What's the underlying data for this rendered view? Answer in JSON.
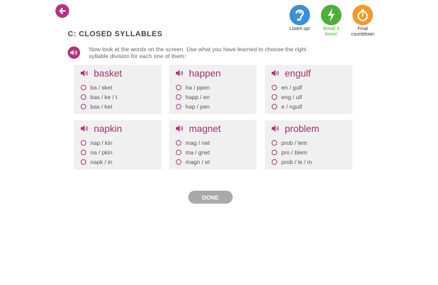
{
  "toolbar": {
    "listen": {
      "label": "Listen up!",
      "color": "#3a8fd6"
    },
    "break": {
      "label": "Break it down!",
      "color": "#4fae3a"
    },
    "final": {
      "label": "Final countdown",
      "color": "#f29a2e"
    }
  },
  "section": {
    "title": "C:  CLOSED SYLLABLES"
  },
  "instructions": "Now look at the words on the screen. Use what you have learned to choose the right syllable division for each one of them:",
  "cards": [
    {
      "word": "basket",
      "options": [
        "ba / sket",
        "bas / ke / t",
        "bas / ket"
      ]
    },
    {
      "word": "happen",
      "options": [
        "ha / ppen",
        "happ / en",
        "hap / pen"
      ]
    },
    {
      "word": "engulf",
      "options": [
        "en / gulf",
        "eng / ulf",
        "e / ngulf"
      ]
    },
    {
      "word": "napkin",
      "options": [
        "nap / kin",
        "na / pkin",
        "napk / in"
      ]
    },
    {
      "word": "magnet",
      "options": [
        "mag / net",
        "ma / gnet",
        "magn / et"
      ]
    },
    {
      "word": "problem",
      "options": [
        "prob / lem",
        "pro / blem",
        "prob / le / m"
      ]
    }
  ],
  "done_label": "DONE",
  "colors": {
    "accent": "#b5307f",
    "word": "#a0306e",
    "card_bg": "#f0f0f0",
    "done_bg": "#a9a9a9"
  }
}
